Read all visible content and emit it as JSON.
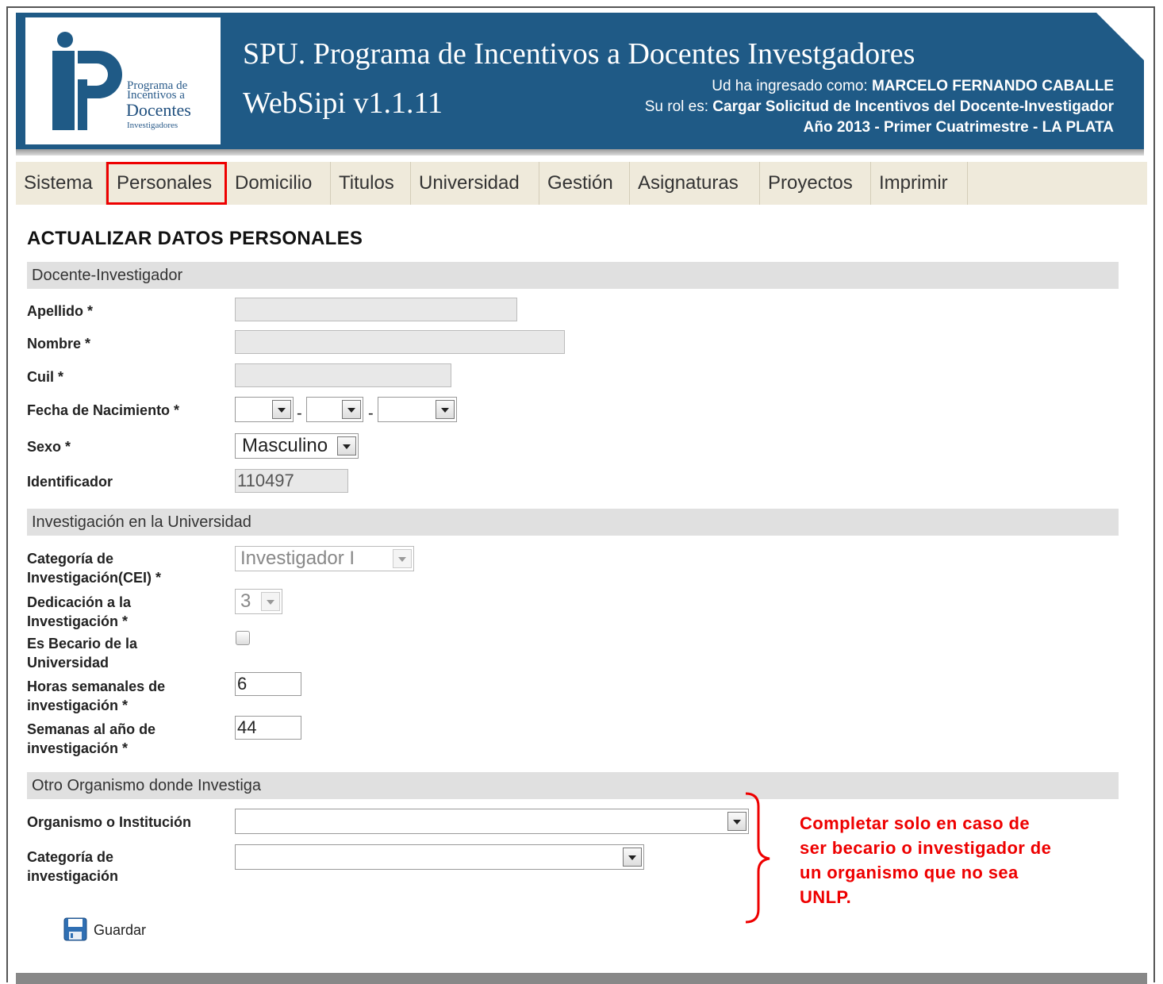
{
  "header": {
    "logo": {
      "line1": "Programa de",
      "line2": "Incentivos a",
      "line3": "Docentes",
      "line4": "Investigadores"
    },
    "title": "SPU. Programa de Incentivos a Docentes Investgadores",
    "version": "WebSipi v1.1.11",
    "user_prefix": "Ud ha ingresado como:",
    "user_name": "MARCELO FERNANDO CABALLE",
    "role_prefix": "Su rol es:",
    "role_name": "Cargar Solicitud de Incentivos del Docente-Investigador",
    "period": "Año 2013 - Primer Cuatrimestre - LA PLATA"
  },
  "menu": [
    "Sistema",
    "Personales",
    "Domicilio",
    "Titulos",
    "Universidad",
    "Gestión",
    "Asignaturas",
    "Proyectos",
    "Imprimir"
  ],
  "menu_active": "Personales",
  "page_title": "ACTUALIZAR DATOS PERSONALES",
  "sections": {
    "docente": "Docente-Investigador",
    "investigacion": "Investigación en la Universidad",
    "otro": "Otro Organismo donde Investiga"
  },
  "fields": {
    "apellido": {
      "label": "Apellido *",
      "value": ""
    },
    "nombre": {
      "label": "Nombre *",
      "value": ""
    },
    "cuil": {
      "label": "Cuil *",
      "value": ""
    },
    "fecha": {
      "label": "Fecha de Nacimiento *",
      "separator": "-"
    },
    "sexo": {
      "label": "Sexo *",
      "value": "Masculino"
    },
    "identificador": {
      "label": "Identificador",
      "value": "110497"
    },
    "categoria_cei": {
      "label_1": "Categoría de",
      "label_2": "Investigación(CEI) *",
      "value": "Investigador I"
    },
    "dedicacion": {
      "label_1": "Dedicación a la",
      "label_2": "Investigación *",
      "value": "3"
    },
    "becario": {
      "label_1": "Es Becario de la",
      "label_2": "Universidad",
      "checked": false
    },
    "horas": {
      "label_1": "Horas semanales de",
      "label_2": "investigación *",
      "value": "6"
    },
    "semanas": {
      "label_1": "Semanas al año de",
      "label_2": "investigación *",
      "value": "44"
    },
    "organismo": {
      "label": "Organismo o Institución",
      "value": ""
    },
    "categoria_otro": {
      "label_1": "Categoría de",
      "label_2": "investigación",
      "value": ""
    }
  },
  "note": "Completar solo en caso de ser becario o investigador de un organismo que no sea UNLP.",
  "save_label": "Guardar",
  "colors": {
    "header": "#1f5a86",
    "menu_bg": "#efeadb",
    "highlight": "#ee0000",
    "section_bg": "#e0e0e0"
  }
}
